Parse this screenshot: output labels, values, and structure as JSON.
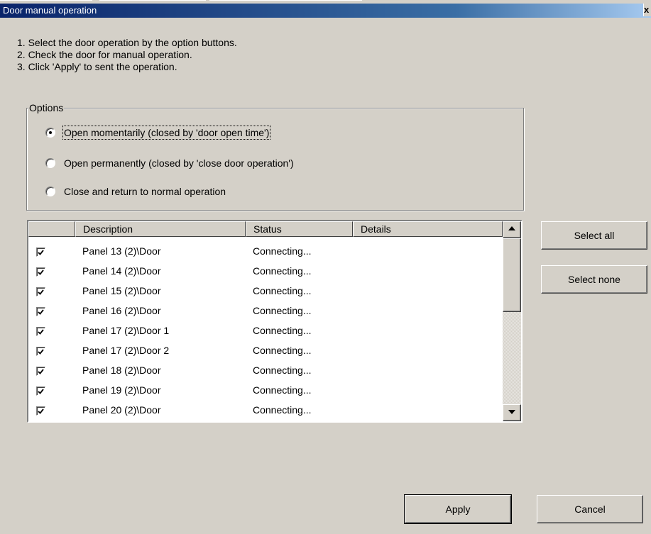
{
  "window": {
    "title": "Door manual operation",
    "close_glyph": "x"
  },
  "instructions": [
    "1. Select the door operation by the option buttons.",
    "2. Check the door for manual operation.",
    "3. Click 'Apply' to sent the operation."
  ],
  "options": {
    "label": "Options",
    "items": [
      {
        "label": "Open momentarily (closed by 'door open time')",
        "selected": true
      },
      {
        "label": "Open permanently (closed by 'close door operation')",
        "selected": false
      },
      {
        "label": "Close and return to normal operation",
        "selected": false
      }
    ]
  },
  "list": {
    "columns": [
      "",
      "Description",
      "Status",
      "Details"
    ],
    "rows": [
      {
        "checked": true,
        "description": "Panel 13 (2)\\Door",
        "status": "Connecting...",
        "details": ""
      },
      {
        "checked": true,
        "description": "Panel 14 (2)\\Door",
        "status": "Connecting...",
        "details": ""
      },
      {
        "checked": true,
        "description": "Panel 15 (2)\\Door",
        "status": "Connecting...",
        "details": ""
      },
      {
        "checked": true,
        "description": "Panel 16 (2)\\Door",
        "status": "Connecting...",
        "details": ""
      },
      {
        "checked": true,
        "description": "Panel 17 (2)\\Door 1",
        "status": "Connecting...",
        "details": ""
      },
      {
        "checked": true,
        "description": "Panel 17 (2)\\Door 2",
        "status": "Connecting...",
        "details": ""
      },
      {
        "checked": true,
        "description": "Panel 18 (2)\\Door",
        "status": "Connecting...",
        "details": ""
      },
      {
        "checked": true,
        "description": "Panel 19 (2)\\Door",
        "status": "Connecting...",
        "details": ""
      },
      {
        "checked": true,
        "description": "Panel 20 (2)\\Door",
        "status": "Connecting...",
        "details": ""
      }
    ]
  },
  "buttons": {
    "select_all": "Select all",
    "select_none": "Select none",
    "apply": "Apply",
    "cancel": "Cancel"
  },
  "colors": {
    "face": "#d4d0c8",
    "title_start": "#0a246a",
    "title_end": "#a6caf0"
  },
  "icons": {
    "check": "checkmark-icon",
    "scroll_up": "arrow-up-icon",
    "scroll_down": "arrow-down-icon"
  }
}
